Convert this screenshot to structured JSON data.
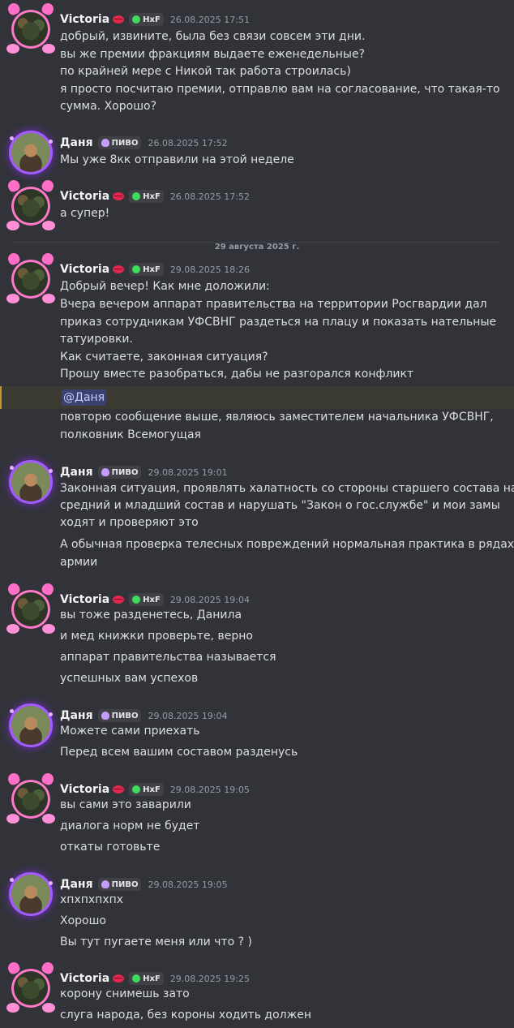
{
  "users": {
    "victoria": {
      "name": "Victoria",
      "tag": "HxF"
    },
    "danya": {
      "name": "Даня",
      "tag": "ПИВО"
    }
  },
  "date_divider": "29 августа 2025 г.",
  "messages": [
    {
      "user": "Victoria",
      "tag": "HxF",
      "time": "26.08.2025 17:51",
      "lines": [
        "добрый, извините, была без связи совсем эти дни.",
        "вы же премии фракциям выдаете еженедельные?",
        "по крайней мере с Никой так работа строилась)",
        "я просто посчитаю премии, отправлю вам на согласование, что такая-то",
        "сумма. Хорошо?"
      ]
    },
    {
      "user": "Даня",
      "tag": "ПИВО",
      "time": "26.08.2025 17:52",
      "lines": [
        "Мы уже 8кк отправили на этой неделе"
      ]
    },
    {
      "user": "Victoria",
      "tag": "HxF",
      "time": "26.08.2025 17:52",
      "lines": [
        "а супер!"
      ]
    },
    {
      "user": "Victoria",
      "tag": "HxF",
      "time": "29.08.2025 18:26",
      "lines": [
        "Добрый вечер! Как мне доложили:",
        "Вчера вечером аппарат правительства на территории Росгвардии дал",
        "приказ сотрудникам УФСВНГ раздеться на плацу и показать нательные",
        "татуировки.",
        "Как считаете, законная ситуация?",
        "Прошу вместе разобраться, дабы не разгорался конфликт"
      ],
      "mention": "@Даня",
      "after_mention": [
        "повторю сообщение выше, являюсь заместителем начальника УФСВНГ,",
        "полковник Всемогущая"
      ]
    },
    {
      "user": "Даня",
      "tag": "ПИВО",
      "time": "29.08.2025 19:01",
      "lines": [
        "Законная ситуация, проявлять халатность со стороны старшего состава на",
        "средний и младший состав и нарушать \"Закон о гос.службе\" и мои замы",
        "ходят и проверяют это",
        "А обычная проверка телесных повреждений нормальная практика в рядах",
        "армии"
      ]
    },
    {
      "user": "Victoria",
      "tag": "HxF",
      "time": "29.08.2025 19:04",
      "lines": [
        "вы тоже разденетесь, Данила",
        "и мед книжки проверьте, верно",
        "аппарат правительства называется",
        "успешных вам успехов"
      ]
    },
    {
      "user": "Даня",
      "tag": "ПИВО",
      "time": "29.08.2025 19:04",
      "lines": [
        "Можете сами приехать",
        "Перед всем вашим составом разденусь"
      ]
    },
    {
      "user": "Victoria",
      "tag": "HxF",
      "time": "29.08.2025 19:05",
      "lines": [
        "вы сами это заварили",
        "диалога норм не будет",
        "откаты готовьте"
      ]
    },
    {
      "user": "Даня",
      "tag": "ПИВО",
      "time": "29.08.2025 19:05",
      "lines": [
        "хпхпхпхпх",
        "Хорошо",
        "Вы тут пугаете меня или что ? )"
      ]
    },
    {
      "user": "Victoria",
      "tag": "HxF",
      "time": "29.08.2025 19:25",
      "lines": [
        "корону снимешь зато",
        "слуга народа, без короны ходить должен"
      ]
    }
  ],
  "colors": {
    "background": "#323339",
    "mention_highlight": "#3b3a32",
    "mention_bar": "#c6932f",
    "skull_icon": "#3ddc5a",
    "heart_icon": "#c89bff"
  }
}
